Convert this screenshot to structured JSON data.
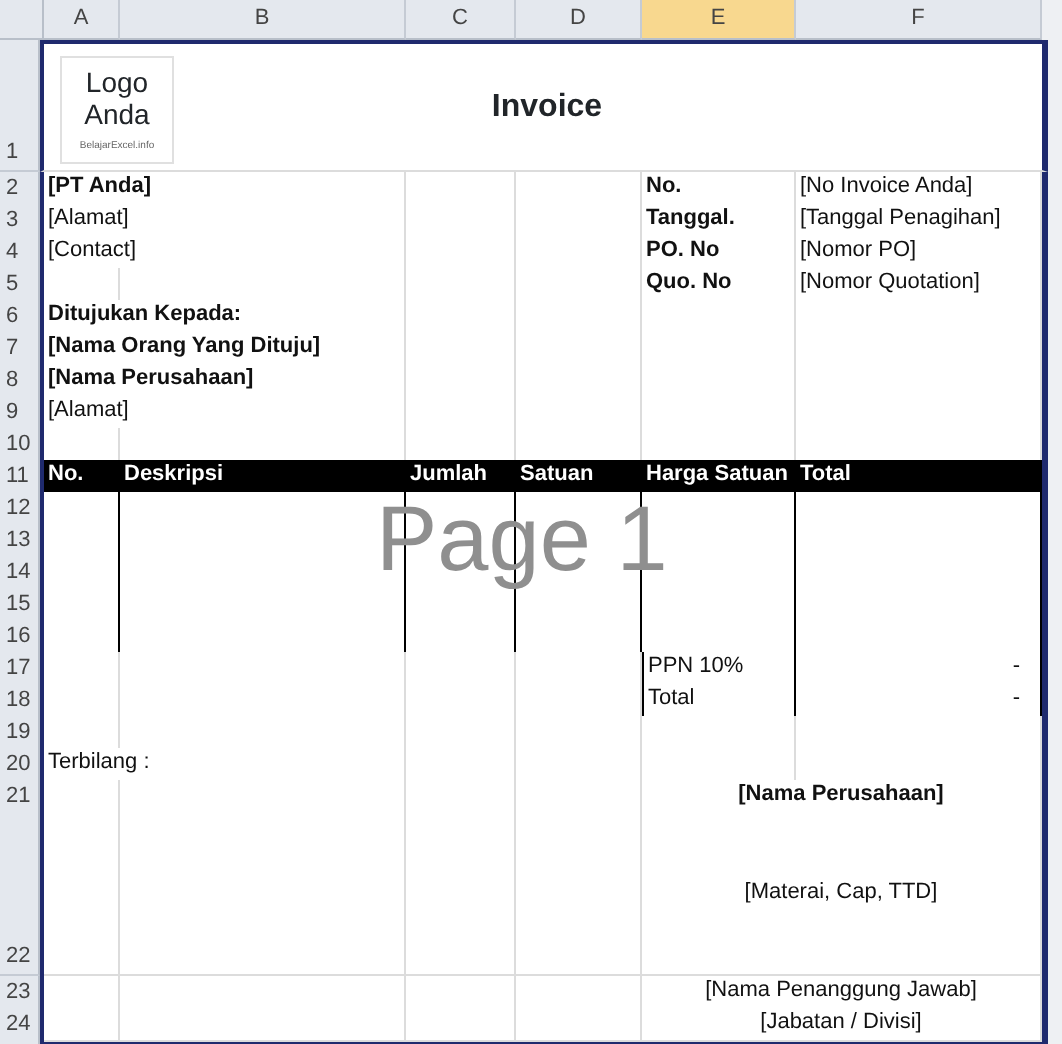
{
  "column_headers": [
    {
      "label": "A",
      "selected": false
    },
    {
      "label": "B",
      "selected": false
    },
    {
      "label": "C",
      "selected": false
    },
    {
      "label": "D",
      "selected": false
    },
    {
      "label": "E",
      "selected": true
    },
    {
      "label": "F",
      "selected": false
    }
  ],
  "logo": {
    "text": "Logo Anda",
    "caption": "BelajarExcel.info"
  },
  "title": "Invoice",
  "rows": [
    {
      "number": "1",
      "kind": "title"
    },
    {
      "number": "2",
      "kind": "plain",
      "column_a": {
        "text": "[PT Anda]",
        "kind": "bold"
      },
      "column_e": {
        "text": "No.",
        "kind": "bold"
      },
      "column_f": {
        "text": "[No Invoice Anda]",
        "kind": "plain"
      }
    },
    {
      "number": "3",
      "kind": "plain",
      "column_a": {
        "text": "[Alamat]",
        "kind": "plain"
      },
      "column_e": {
        "text": "Tanggal.",
        "kind": "bold"
      },
      "column_f": {
        "text": "[Tanggal Penagihan]",
        "kind": "plain"
      }
    },
    {
      "number": "4",
      "kind": "plain",
      "column_a": {
        "text": "[Contact]",
        "kind": "plain"
      },
      "column_e": {
        "text": "PO. No",
        "kind": "bold"
      },
      "column_f": {
        "text": "[Nomor PO]",
        "kind": "plain"
      }
    },
    {
      "number": "5",
      "kind": "plain",
      "column_e": {
        "text": "Quo. No",
        "kind": "bold"
      },
      "column_f": {
        "text": "[Nomor Quotation]",
        "kind": "plain"
      }
    },
    {
      "number": "6",
      "kind": "plain",
      "column_a": {
        "text": "Ditujukan Kepada:",
        "kind": "bold"
      }
    },
    {
      "number": "7",
      "kind": "plain",
      "column_a": {
        "text": "[Nama Orang Yang Dituju]",
        "kind": "bold"
      }
    },
    {
      "number": "8",
      "kind": "plain",
      "column_a": {
        "text": "[Nama Perusahaan]",
        "kind": "bold"
      }
    },
    {
      "number": "9",
      "kind": "plain",
      "column_a": {
        "text": "[Alamat]",
        "kind": "plain"
      }
    },
    {
      "number": "10",
      "kind": "plain"
    },
    {
      "number": "11",
      "kind": "header",
      "column_a": {
        "text": "No.",
        "kind": "bold"
      },
      "column_b": {
        "text": "Deskripsi",
        "kind": "bold"
      },
      "column_c": {
        "text": "Jumlah",
        "kind": "bold"
      },
      "column_d": {
        "text": "Satuan",
        "kind": "bold"
      },
      "column_e": {
        "text": "Harga Satuan",
        "kind": "bold"
      },
      "column_f": {
        "text": "Total",
        "kind": "bold"
      }
    },
    {
      "number": "12",
      "kind": "item"
    },
    {
      "number": "13",
      "kind": "item"
    },
    {
      "number": "14",
      "kind": "item"
    },
    {
      "number": "15",
      "kind": "item"
    },
    {
      "number": "16",
      "kind": "item"
    },
    {
      "number": "17",
      "kind": "summary",
      "column_e": {
        "text": "PPN 10%",
        "kind": "plain"
      },
      "column_f": {
        "text": "-",
        "kind": "right"
      }
    },
    {
      "number": "18",
      "kind": "summary",
      "column_e": {
        "text": "Total",
        "kind": "plain"
      },
      "column_f": {
        "text": "-",
        "kind": "right"
      }
    },
    {
      "number": "19",
      "kind": "plain"
    },
    {
      "number": "20",
      "kind": "plain",
      "column_a": {
        "text": "Terbilang :",
        "kind": "plain"
      }
    },
    {
      "number": "21",
      "kind": "plain",
      "column_e": {
        "text": "[Nama Perusahaan]",
        "kind": "center_bold"
      }
    },
    {
      "number": "22",
      "kind": "signature",
      "column_e": {
        "text": "[Materai, Cap, TTD]",
        "kind": "center"
      }
    },
    {
      "number": "23",
      "kind": "plain",
      "column_e": {
        "text": "[Nama Penanggung Jawab]",
        "kind": "center"
      }
    },
    {
      "number": "24",
      "kind": "plain",
      "column_e": {
        "text": "[Jabatan / Divisi]",
        "kind": "center"
      }
    }
  ],
  "page_label": "Page 1"
}
